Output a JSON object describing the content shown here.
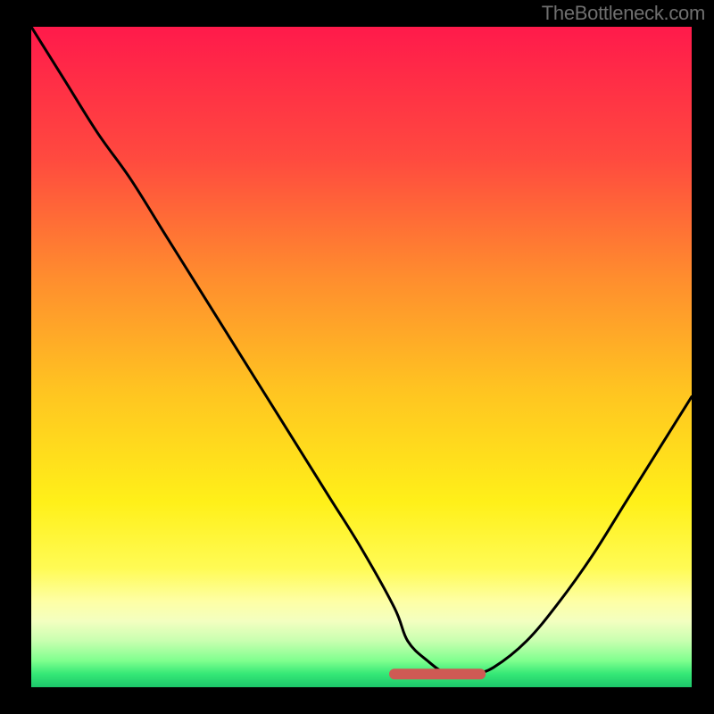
{
  "watermark": "TheBottleneck.com",
  "chart_data": {
    "type": "line",
    "title": "",
    "xlabel": "",
    "ylabel": "",
    "xlim": [
      0,
      100
    ],
    "ylim": [
      0,
      100
    ],
    "series": [
      {
        "name": "bottleneck-curve",
        "x": [
          0,
          5,
          10,
          15,
          20,
          25,
          30,
          35,
          40,
          45,
          50,
          55,
          57,
          60,
          63,
          66,
          67,
          70,
          75,
          80,
          85,
          90,
          95,
          100
        ],
        "values": [
          100,
          92,
          84,
          77,
          69,
          61,
          53,
          45,
          37,
          29,
          21,
          12,
          7,
          4,
          2,
          2,
          2,
          3,
          7,
          13,
          20,
          28,
          36,
          44
        ]
      },
      {
        "name": "optimal-band",
        "x": [
          55,
          57,
          60,
          63,
          66,
          68
        ],
        "values": [
          2,
          2,
          2,
          2,
          2,
          2
        ]
      }
    ],
    "gradient_stops": [
      {
        "pct": 0,
        "color": "#ff1a4b"
      },
      {
        "pct": 20,
        "color": "#ff4a3f"
      },
      {
        "pct": 38,
        "color": "#ff8d2e"
      },
      {
        "pct": 55,
        "color": "#ffc421"
      },
      {
        "pct": 72,
        "color": "#fff019"
      },
      {
        "pct": 82,
        "color": "#fffb55"
      },
      {
        "pct": 87,
        "color": "#feffa5"
      },
      {
        "pct": 90,
        "color": "#f3ffc0"
      },
      {
        "pct": 93,
        "color": "#c8ffb0"
      },
      {
        "pct": 96,
        "color": "#7fff8e"
      },
      {
        "pct": 98,
        "color": "#35e876"
      },
      {
        "pct": 100,
        "color": "#1cc66a"
      }
    ],
    "optimal_marker_color": "#cf5a54"
  }
}
